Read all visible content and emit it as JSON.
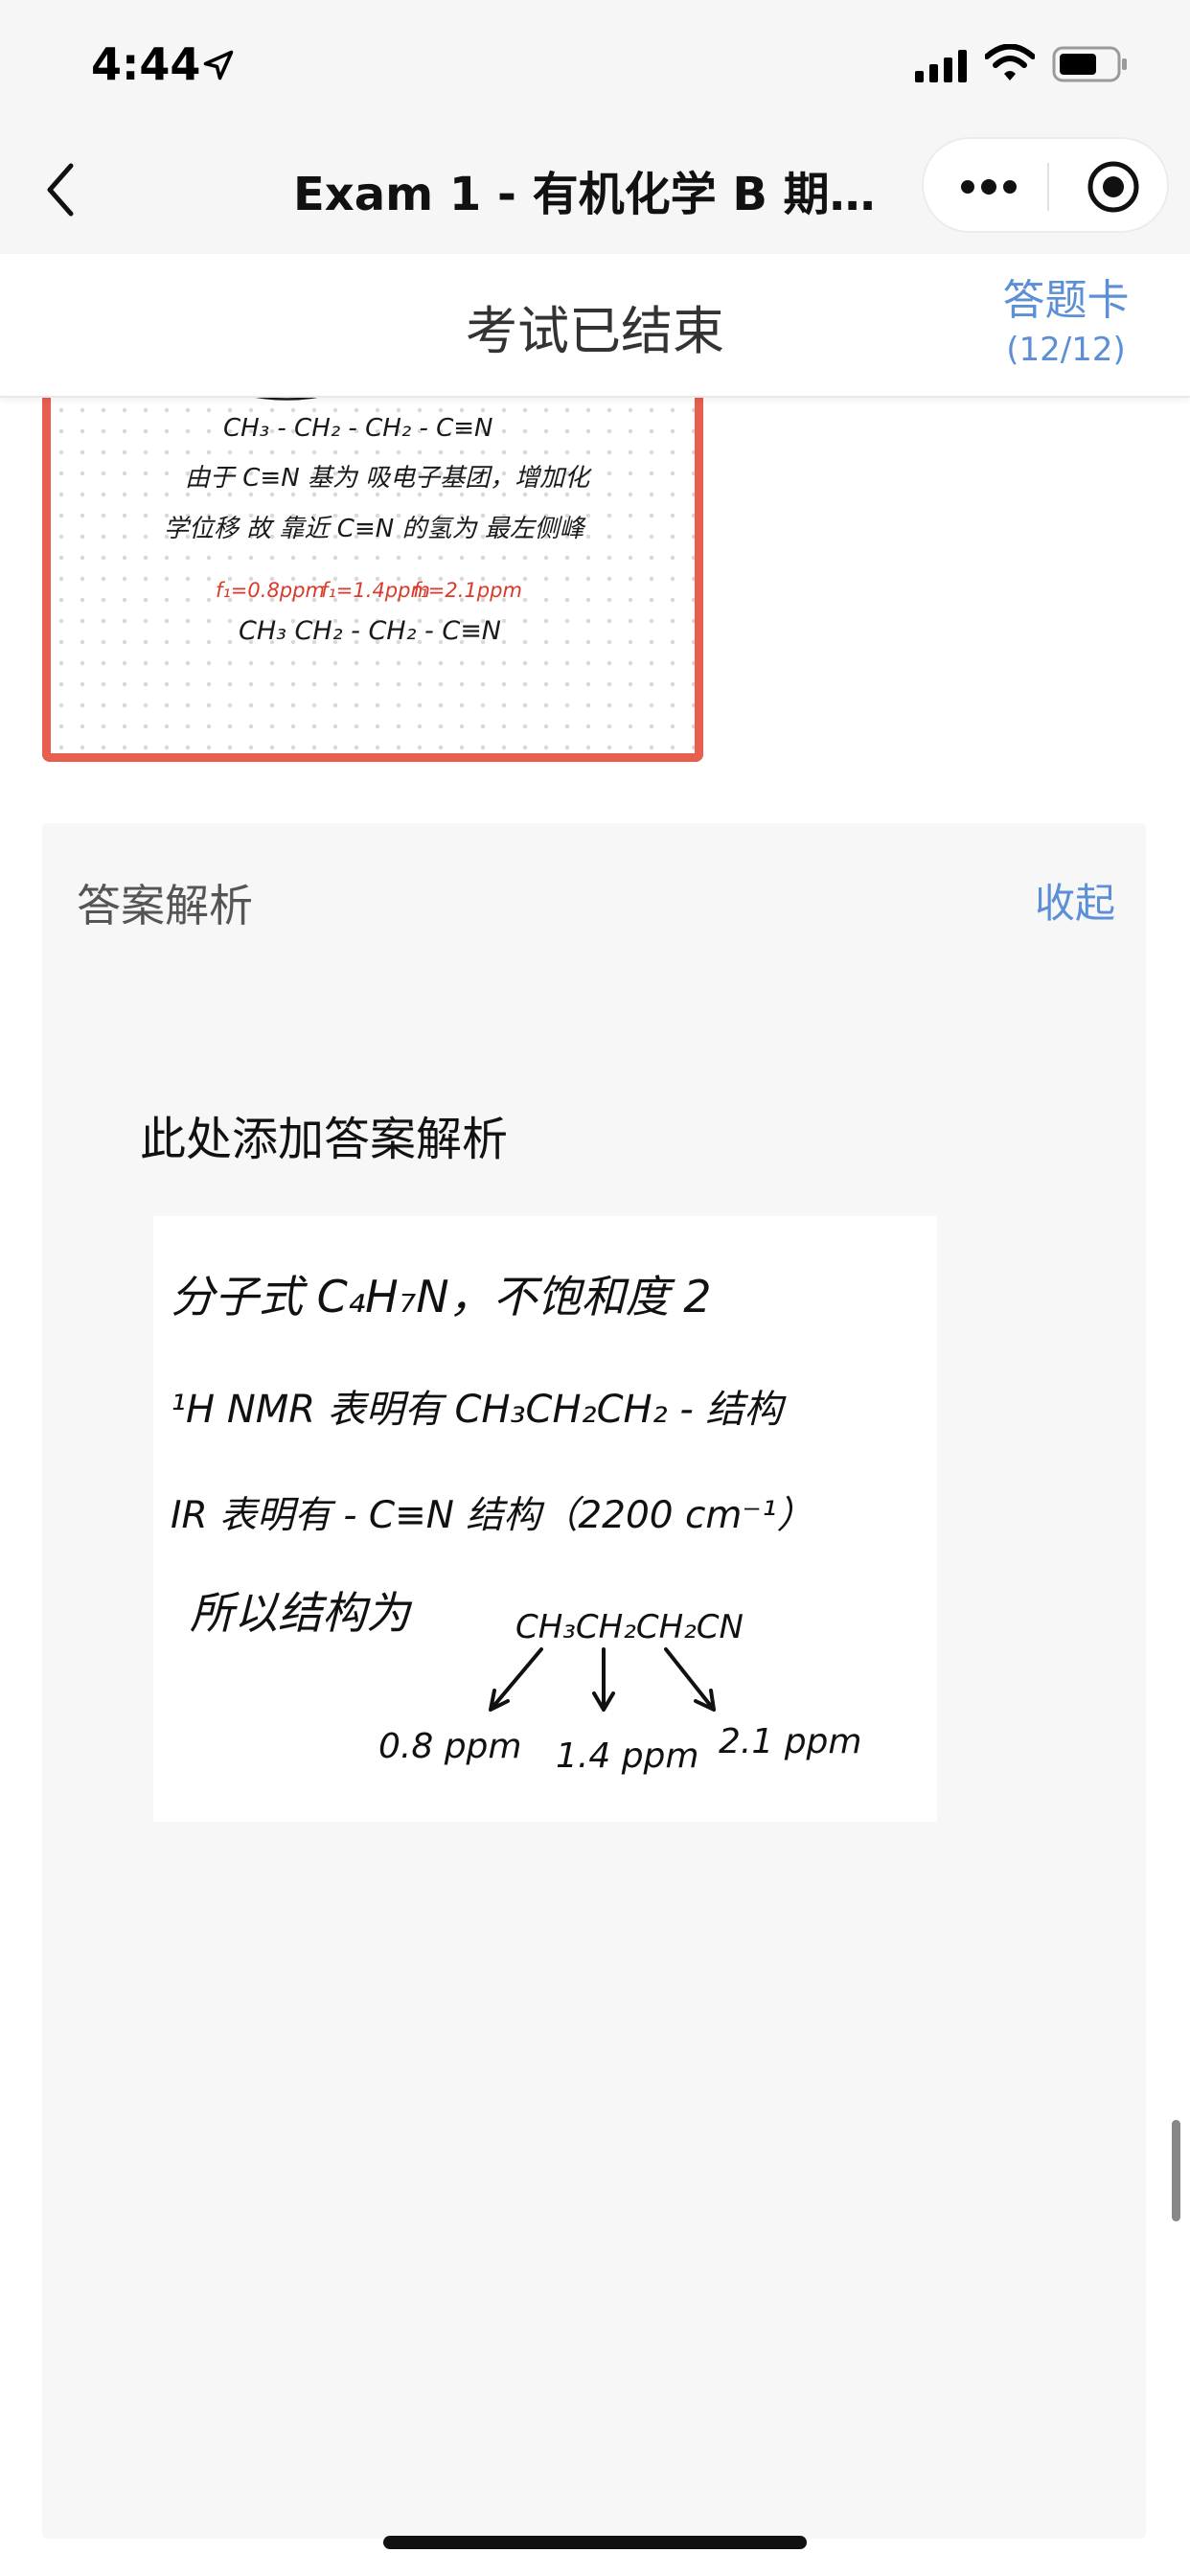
{
  "status_bar": {
    "time": "4:44",
    "icons": [
      "location-arrow-icon",
      "signal-icon",
      "wifi-icon",
      "battery-icon"
    ]
  },
  "nav": {
    "title": "Exam 1 - 有机化学 B 期中…",
    "icons": [
      "back-chevron-icon",
      "more-dots-icon",
      "target-icon"
    ]
  },
  "exam": {
    "status": "考试已结束",
    "answer_card_label": "答题卡",
    "answer_card_count": "(12/12)"
  },
  "student_answer": {
    "lines": [
      "CH₃ - CH₂ - CH₂ - C≡N",
      "由于 C≡N 基为 吸电子基团，增加化",
      "学位移 故 靠近 C≡N 的氢为 最左侧峰",
      "CH₃ CH₂ - CH₂ - C≡N"
    ],
    "annotations": [
      "f₁=0.8ppm",
      "f₁=1.4ppm",
      "f₁=2.1ppm"
    ],
    "colors": {
      "border": "#e85e4f",
      "annotation": "#d93a2b",
      "ink": "#1a1a1a"
    }
  },
  "analysis": {
    "title": "答案解析",
    "collapse_label": "收起",
    "placeholder": "此处添加答案解析",
    "image_lines": {
      "line1": "分子式 C₄H₇N，不饱和度 2",
      "line2": "¹H NMR 表明有 CH₃CH₂CH₂ - 结构",
      "line3": "IR 表明有 - C≡N 结构（2200 cm⁻¹）",
      "line4_prefix": "所以结构为",
      "line4_formula": "CH₃CH₂CH₂CN",
      "shifts": [
        "0.8 ppm",
        "1.4 ppm",
        "2.1 ppm"
      ]
    }
  },
  "colors": {
    "accent": "#5c8fd6",
    "topbar_bg": "#f6f6f6",
    "panel_bg": "#f7f7f7"
  }
}
